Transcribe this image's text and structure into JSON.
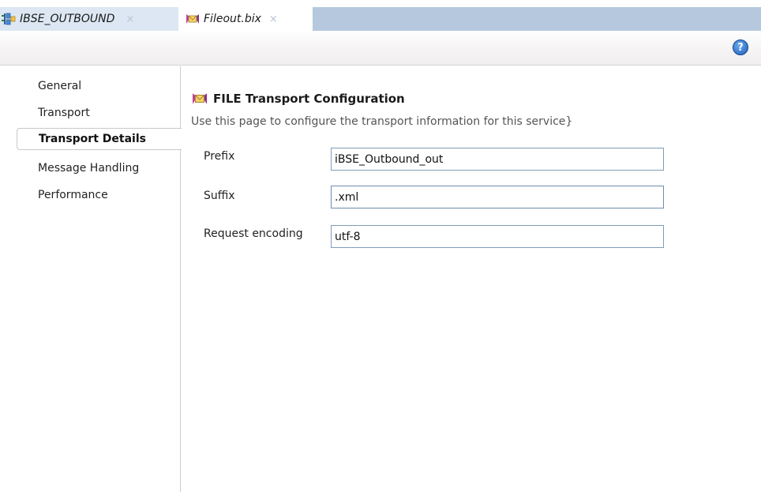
{
  "tabs": [
    {
      "label": "IBSE_OUTBOUND",
      "close": "×",
      "icon": "composite-icon"
    },
    {
      "label": "Fileout.bix",
      "close": "×",
      "icon": "file-adapter-icon"
    }
  ],
  "toolbar": {
    "help_label": "?"
  },
  "nav": {
    "items": [
      {
        "label": "General"
      },
      {
        "label": "Transport"
      },
      {
        "label": "Transport Details",
        "selected": true
      },
      {
        "label": "Message Handling"
      },
      {
        "label": "Performance"
      }
    ]
  },
  "section": {
    "title": "FILE Transport Configuration",
    "description": "Use this page to configure the transport information for this service}"
  },
  "fields": {
    "prefix": {
      "label": "Prefix",
      "value": "iBSE_Outbound_out"
    },
    "suffix": {
      "label": "Suffix",
      "value": ".xml"
    },
    "encoding": {
      "label": "Request encoding",
      "value": "utf-8"
    }
  },
  "colors": {
    "tab_active_bg": "#dce7f3",
    "tab_strip_bg": "#b6c8dd",
    "input_border": "#7f9db9",
    "help_blue": "#1f5fb8"
  }
}
